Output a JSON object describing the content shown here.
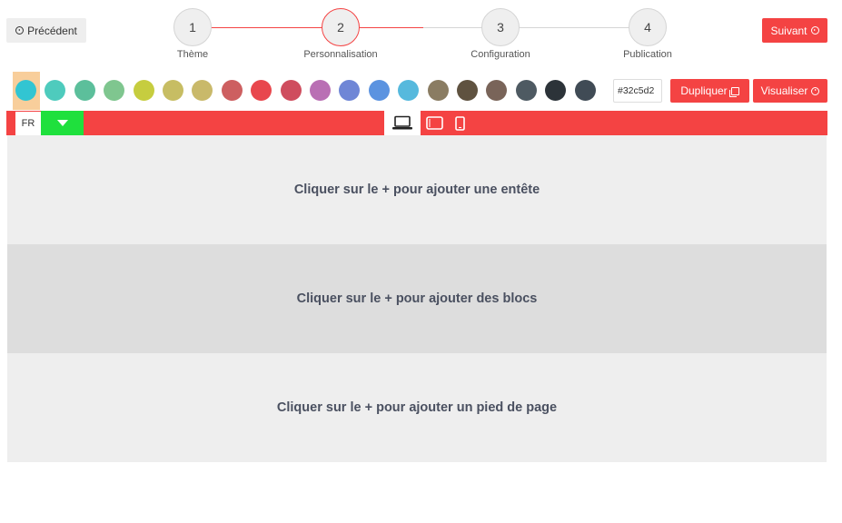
{
  "nav": {
    "prev_label": "Précédent",
    "next_label": "Suivant"
  },
  "steps": [
    {
      "num": "1",
      "label": "Thème"
    },
    {
      "num": "2",
      "label": "Personnalisation"
    },
    {
      "num": "3",
      "label": "Configuration"
    },
    {
      "num": "4",
      "label": "Publication"
    }
  ],
  "active_step": 2,
  "palette": {
    "colors": [
      "#32c5d2",
      "#4ecbbd",
      "#5cbf9b",
      "#7fc68f",
      "#c6cd3f",
      "#c7bd63",
      "#c9b96a",
      "#cd5f60",
      "#e8474d",
      "#cf4d5e",
      "#b96fb4",
      "#6f86d6",
      "#5b93e0",
      "#56b9dd",
      "#8a7c62",
      "#5f5240",
      "#796459",
      "#4e5a62",
      "#2c3339",
      "#404b55"
    ],
    "selected": "#32c5d2",
    "hex_value": "#32c5d2"
  },
  "actions": {
    "duplicate_label": "Dupliquer",
    "preview_label": "Visualiser"
  },
  "language": "FR",
  "devices": [
    "laptop",
    "tablet",
    "phone"
  ],
  "active_device": "laptop",
  "colors": {
    "accent": "#f44343",
    "green": "#1fe03d",
    "section_light": "#eeeeee",
    "section_dark": "#dddddd"
  },
  "sections": {
    "header": "Cliquer sur le + pour ajouter une entête",
    "blocks": "Cliquer sur le + pour ajouter des blocs",
    "footer": "Cliquer sur le + pour ajouter un pied de page"
  }
}
